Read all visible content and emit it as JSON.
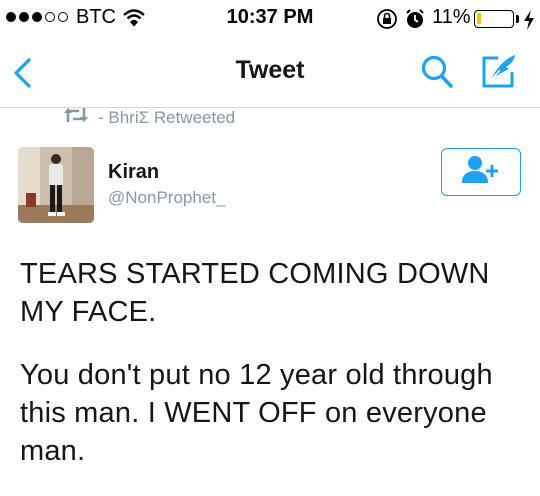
{
  "status_bar": {
    "carrier": "BTC",
    "time": "10:37 PM",
    "battery_percent": "11%",
    "battery_level": 0.11,
    "signal_bars": 3,
    "signal_total": 5
  },
  "nav": {
    "title": "Tweet",
    "back_icon": "chevron-left-icon",
    "search_icon": "search-icon",
    "compose_icon": "compose-icon"
  },
  "retweet": {
    "text": "- BhriΣ Retweeted"
  },
  "author": {
    "name": "Kiran",
    "handle": "@NonProphet_"
  },
  "tweet": {
    "paragraph1": "TEARS STARTED COMING DOWN MY FACE.",
    "paragraph2": "You don't put no 12 year old through this man. I WENT OFF on everyone man."
  },
  "colors": {
    "accent": "#1da1f2",
    "secondary_text": "#8899a6",
    "battery": "#f5c400"
  }
}
